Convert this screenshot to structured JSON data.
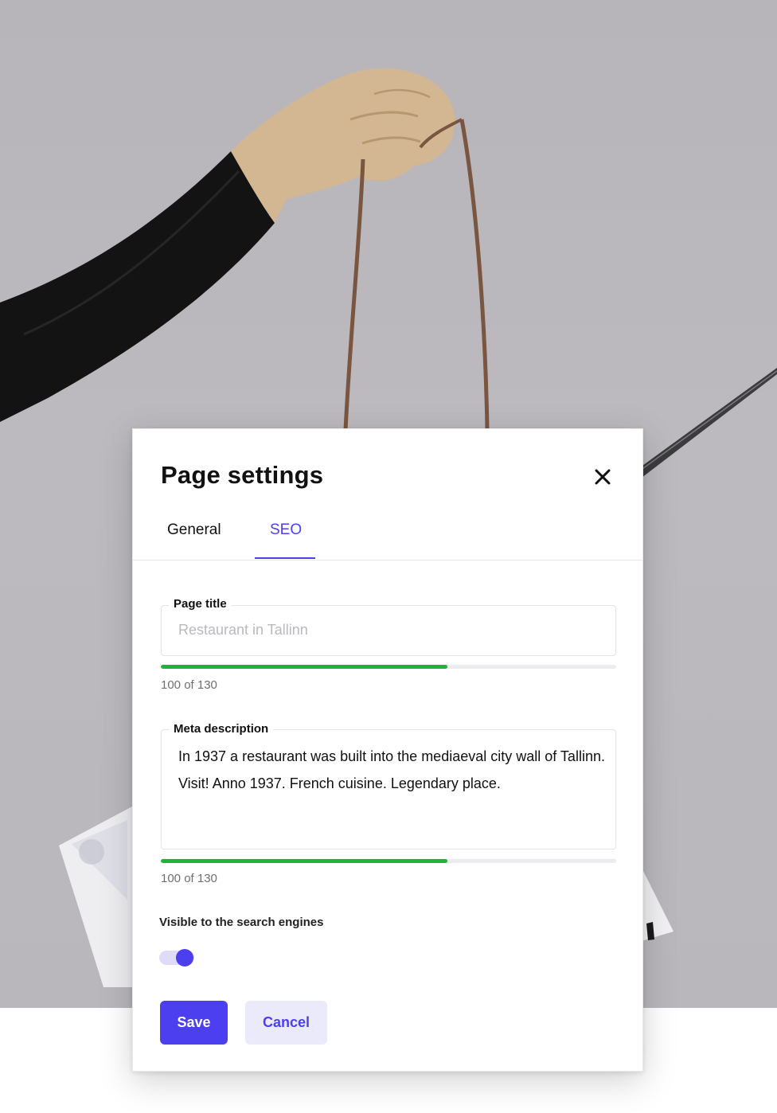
{
  "modal": {
    "title": "Page settings",
    "close_icon": "close-icon"
  },
  "tabs": [
    {
      "label": "General",
      "active": false
    },
    {
      "label": "SEO",
      "active": true
    }
  ],
  "fields": {
    "page_title": {
      "label": "Page title",
      "placeholder": "Restaurant in Tallinn",
      "value": "",
      "counter": "100 of 130",
      "progress": 0.63
    },
    "meta_description": {
      "label": "Meta description",
      "value": "In 1937 a restaurant was built into the mediaeval city wall of Tallinn. Visit! Anno 1937. French cuisine. Legendary place.",
      "counter": "100 of 130",
      "progress": 0.63
    }
  },
  "visibility": {
    "label": "Visible to the search engines",
    "enabled": true
  },
  "actions": {
    "save_label": "Save",
    "cancel_label": "Cancel"
  },
  "colors": {
    "accent": "#4b3ff0",
    "progress": "#22b235",
    "cancel_bg": "#ebeafb"
  }
}
